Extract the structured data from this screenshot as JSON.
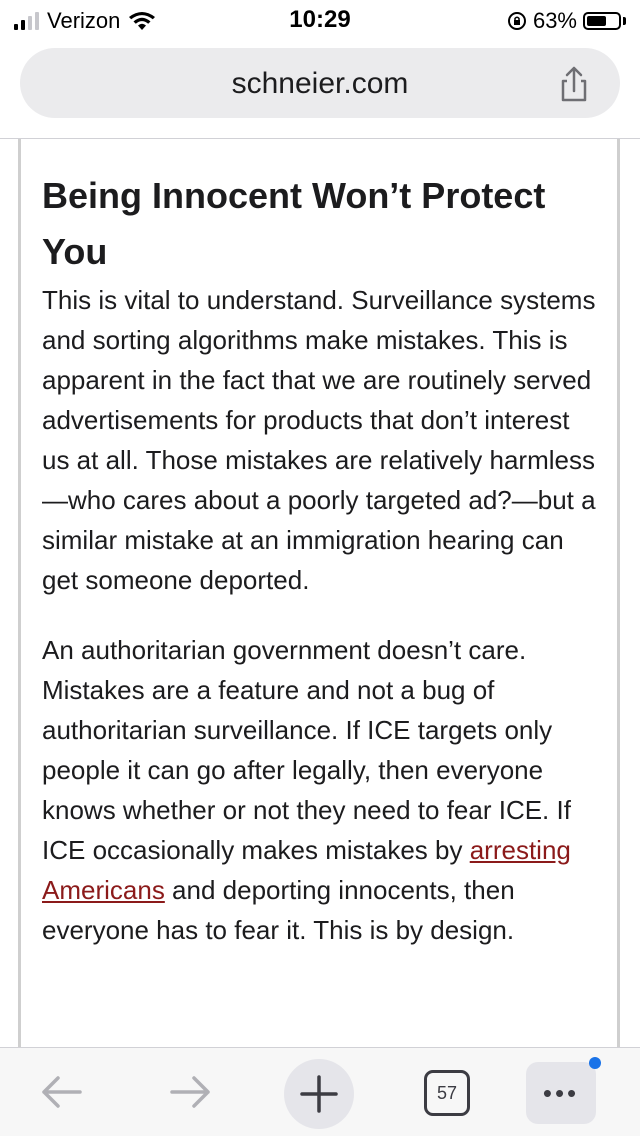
{
  "status_bar": {
    "carrier": "Verizon",
    "time": "10:29",
    "battery_percent": "63%",
    "battery_level": 0.63,
    "icons": [
      "signal-icon",
      "wifi-icon",
      "orientation-lock-icon",
      "battery-icon"
    ]
  },
  "browser": {
    "url": "schneier.com",
    "share_icon": "share-icon"
  },
  "article": {
    "heading": "Being Innocent Won’t Protect You",
    "paragraph1": "This is vital to understand. Surveillance systems and sorting algorithms make mistakes. This is apparent in the fact that we are routinely served advertisements for products that don’t interest us at all. Those mistakes are relatively harmless—who cares about a poorly targeted ad?—but a similar mistake at an immigration hearing can get someone deported.",
    "paragraph2_before": "An authoritarian government doesn’t care. Mistakes are a feature and not a bug of authoritarian surveillance. If ICE targets only people it can go after legally, then everyone knows whether or not they need to fear ICE. If ICE occasionally makes mistakes by ",
    "paragraph2_link": "arresting Americans",
    "paragraph2_after": " and deporting innocents, then everyone has to fear it. This is by design.",
    "link_color": "#8b1a1a"
  },
  "toolbar": {
    "back_icon": "back-arrow-icon",
    "forward_icon": "forward-arrow-icon",
    "new_tab_icon": "plus-icon",
    "tab_count": "57",
    "more_icon": "more-dots-icon",
    "more_dots": "•••",
    "notification_color": "#1a73e8"
  }
}
